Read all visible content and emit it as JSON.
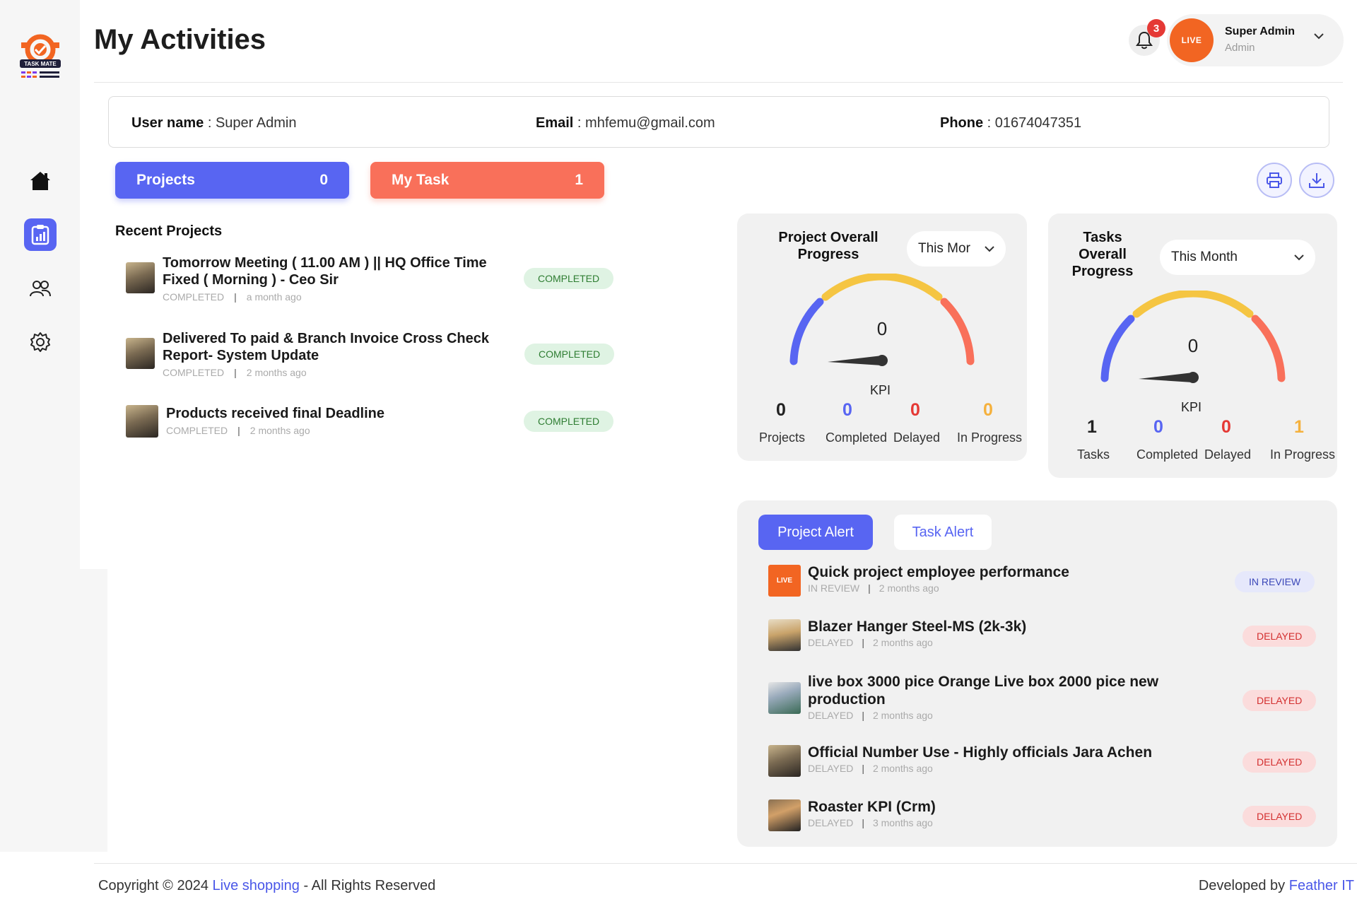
{
  "app": {
    "logo_text": "TASK MATE"
  },
  "page": {
    "title": "My Activities"
  },
  "header": {
    "notification_count": "3",
    "avatar_text": "LIVE",
    "user_name": "Super Admin",
    "user_role": "Admin"
  },
  "sidebar": {
    "items": [
      {
        "name": "home"
      },
      {
        "name": "activities",
        "active": true
      },
      {
        "name": "users"
      },
      {
        "name": "settings"
      }
    ]
  },
  "user_info": {
    "username_label": "User name",
    "username_value": "Super Admin",
    "email_label": "Email",
    "email_value": "mhfemu@gmail.com",
    "phone_label": "Phone",
    "phone_value": "01674047351"
  },
  "stats": {
    "projects": {
      "label": "Projects",
      "count": "0"
    },
    "mytask": {
      "label": "My Task",
      "count": "1"
    }
  },
  "recent_projects": {
    "title": "Recent Projects",
    "items": [
      {
        "title_line1": "Tomorrow Meeting ( 11.00 AM ) || HQ Office Time",
        "title_line2": "Fixed ( Morning ) - Ceo Sir",
        "status": "COMPLETED",
        "time": "a month ago",
        "badge": "COMPLETED"
      },
      {
        "title_line1": "Delivered To paid & Branch Invoice Cross Check",
        "title_line2": "Report- System Update",
        "status": "COMPLETED",
        "time": "2 months ago",
        "badge": "COMPLETED"
      },
      {
        "title_line1": "Products received final Deadline",
        "title_line2": "",
        "status": "COMPLETED",
        "time": "2 months ago",
        "badge": "COMPLETED"
      }
    ]
  },
  "project_progress": {
    "title_line1": "Project Overall",
    "title_line2": "Progress",
    "select": "This Mor",
    "value": "0",
    "kpi": "KPI",
    "stats": [
      {
        "value": "0",
        "label": "Projects",
        "color": "#222222"
      },
      {
        "value": "0",
        "label": "Completed",
        "color": "#5865f2"
      },
      {
        "value": "0",
        "label": "Delayed",
        "color": "#e53935"
      },
      {
        "value": "0",
        "label": "In Progress",
        "color": "#f5b13d"
      }
    ]
  },
  "task_progress": {
    "title_line1": "Tasks",
    "title_line2": "Overall",
    "title_line3": "Progress",
    "select": "This Month",
    "value": "0",
    "kpi": "KPI",
    "stats": [
      {
        "value": "1",
        "label": "Tasks",
        "color": "#222222"
      },
      {
        "value": "0",
        "label": "Completed",
        "color": "#5865f2"
      },
      {
        "value": "0",
        "label": "Delayed",
        "color": "#e53935"
      },
      {
        "value": "1",
        "label": "In Progress",
        "color": "#f5b13d"
      }
    ]
  },
  "alerts": {
    "tab_active": "Project Alert",
    "tab_inactive": "Task Alert",
    "items": [
      {
        "title_line1": "Quick project employee performance",
        "title_line2": "",
        "status": "IN REVIEW",
        "time": "2 months ago",
        "badge": "IN REVIEW",
        "thumb": "LIVE"
      },
      {
        "title_line1": "Blazer Hanger Steel-MS (2k-3k)",
        "title_line2": "",
        "status": "DELAYED",
        "time": "2 months ago",
        "badge": "DELAYED"
      },
      {
        "title_line1": "live box 3000 pice Orange Live box 2000 pice new",
        "title_line2": "production",
        "status": "DELAYED",
        "time": "2 months ago",
        "badge": "DELAYED"
      },
      {
        "title_line1": "Official Number Use - Highly officials Jara Achen",
        "title_line2": "",
        "status": "DELAYED",
        "time": "2 months ago",
        "badge": "DELAYED"
      },
      {
        "title_line1": "Roaster KPI (Crm)",
        "title_line2": "",
        "status": "DELAYED",
        "time": "3 months ago",
        "badge": "DELAYED"
      }
    ]
  },
  "footer": {
    "copy_prefix": "Copyright © 2024 ",
    "copy_link": "Live shopping",
    "copy_suffix": " - All Rights Reserved",
    "dev_prefix": "Developed by ",
    "dev_link": "Feather IT"
  },
  "colors": {
    "primary": "#5865f2",
    "accent": "#f9705a",
    "brand_orange": "#f26522"
  }
}
